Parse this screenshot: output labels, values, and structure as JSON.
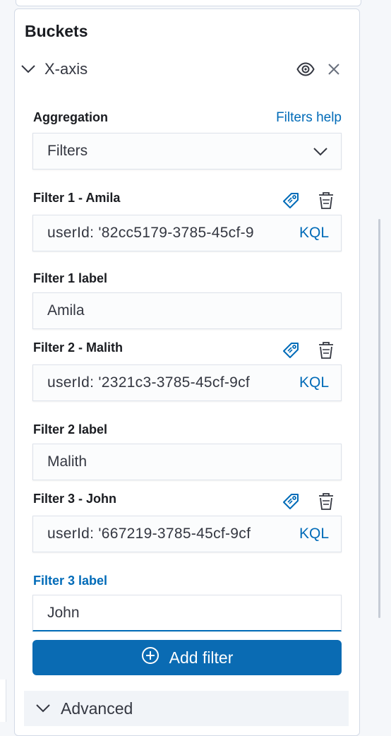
{
  "panel": {
    "title": "Buckets"
  },
  "bucket": {
    "label": "X-axis",
    "aggregation_label": "Aggregation",
    "help_link": "Filters help",
    "aggregation_value": "Filters"
  },
  "filters": [
    {
      "title": "Filter 1 - Amila",
      "query": "userId: '82cc5179-3785-45cf-9",
      "language": "KQL",
      "label_title": "Filter 1 label",
      "label_value": "Amila"
    },
    {
      "title": "Filter 2 - Malith",
      "query": "userId: '2321c3-3785-45cf-9cf",
      "language": "KQL",
      "label_title": "Filter 2 label",
      "label_value": "Malith"
    },
    {
      "title": "Filter 3 - John",
      "query": "userId: '667219-3785-45cf-9cf",
      "language": "KQL",
      "label_title": "Filter 3 label",
      "label_value": "John"
    }
  ],
  "actions": {
    "add_filter": "Add filter"
  },
  "advanced": {
    "label": "Advanced"
  },
  "icons": {
    "collapse": "chevron-down-icon",
    "toggle_visibility": "eye-icon",
    "remove": "close-icon",
    "select": "chevron-down-icon",
    "label_toggle": "tag-icon",
    "delete": "trash-icon",
    "add": "plus-circle-icon"
  },
  "colors": {
    "accent": "#006bb8",
    "button": "#0a6bb3",
    "text": "#343741",
    "heading": "#1a1c21",
    "border": "#d3dae6"
  }
}
